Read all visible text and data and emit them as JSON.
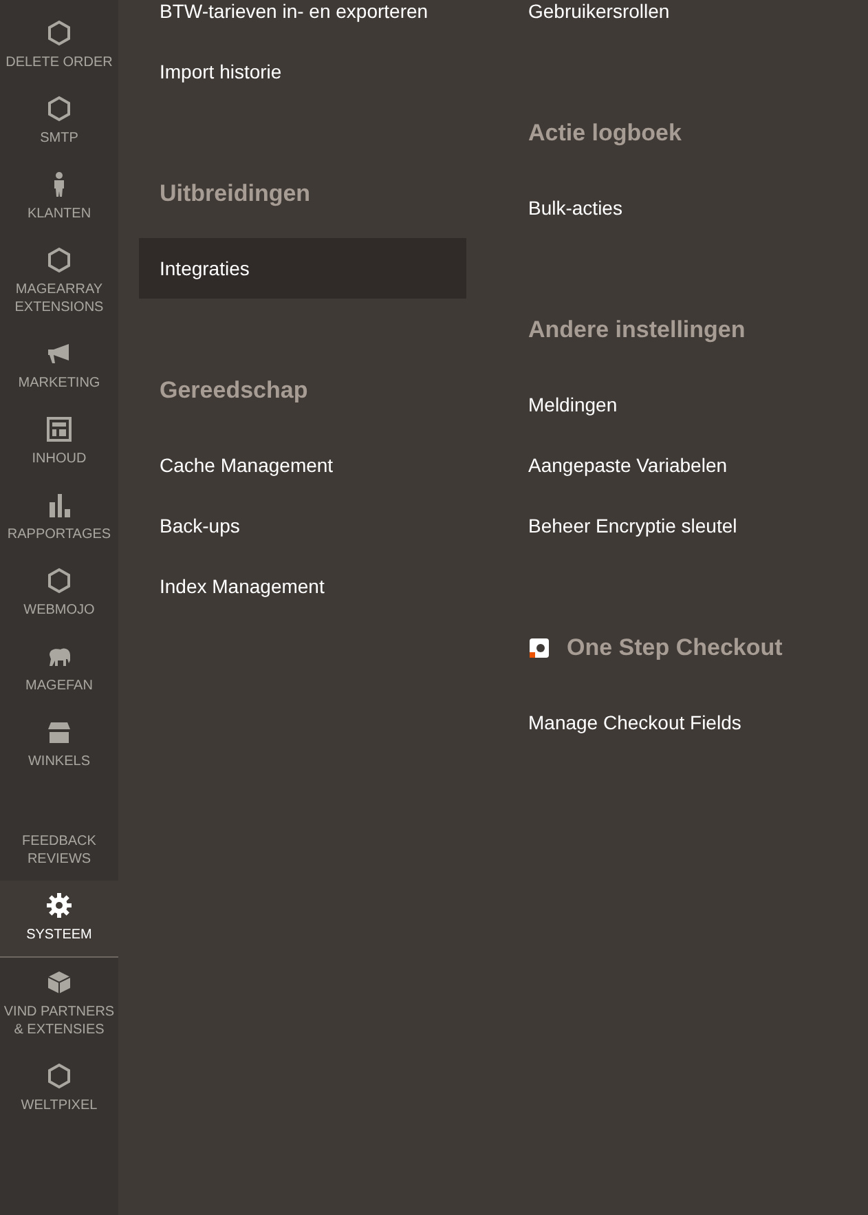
{
  "sidebar": {
    "items": [
      {
        "label": "DELETE ORDER",
        "kind": "hexagon",
        "selected": false
      },
      {
        "label": "SMTP",
        "kind": "hexagon",
        "selected": false
      },
      {
        "label": "KLANTEN",
        "kind": "person",
        "selected": false
      },
      {
        "label": "MAGEARRAY EXTENSIONS",
        "kind": "hexagon",
        "selected": false
      },
      {
        "label": "MARKETING",
        "kind": "megaphone",
        "selected": false
      },
      {
        "label": "INHOUD",
        "kind": "layout",
        "selected": false
      },
      {
        "label": "RAPPORTAGES",
        "kind": "bars",
        "selected": false
      },
      {
        "label": "WEBMOJO",
        "kind": "hexagon",
        "selected": false
      },
      {
        "label": "MAGEFAN",
        "kind": "elephant",
        "selected": false
      },
      {
        "label": "WINKELS",
        "kind": "store",
        "selected": false
      },
      {
        "label": "FEEDBACK REVIEWS",
        "kind": "none",
        "selected": false
      },
      {
        "label": "SYSTEEM",
        "kind": "gear",
        "selected": true
      },
      {
        "label": "VIND PARTNERS & EXTENSIES",
        "kind": "blocks",
        "selected": false
      },
      {
        "label": "WELTPIXEL",
        "kind": "hexagon",
        "selected": false
      }
    ]
  },
  "columns": [
    {
      "sections": [
        {
          "links": [
            {
              "label": "BTW-tarieven in- en exporteren",
              "selected": false
            },
            {
              "label": "Import historie",
              "selected": false
            }
          ]
        },
        {
          "title": "Uitbreidingen",
          "links": [
            {
              "label": "Integraties",
              "selected": true
            }
          ]
        },
        {
          "title": "Gereedschap",
          "links": [
            {
              "label": "Cache Management",
              "selected": false
            },
            {
              "label": "Back-ups",
              "selected": false
            },
            {
              "label": "Index Management",
              "selected": false
            }
          ]
        }
      ]
    },
    {
      "sections": [
        {
          "links": [
            {
              "label": "Gebruikersrollen",
              "selected": false
            }
          ]
        },
        {
          "title": "Actie logboek",
          "links": [
            {
              "label": "Bulk-acties",
              "selected": false
            }
          ]
        },
        {
          "title": "Andere instellingen",
          "links": [
            {
              "label": "Meldingen",
              "selected": false
            },
            {
              "label": "Aangepaste Variabelen",
              "selected": false
            },
            {
              "label": "Beheer Encryptie sleutel",
              "selected": false
            }
          ]
        },
        {
          "title": "One Step Checkout",
          "logo": true,
          "links": [
            {
              "label": "Manage Checkout Fields",
              "selected": false
            }
          ]
        }
      ]
    }
  ]
}
